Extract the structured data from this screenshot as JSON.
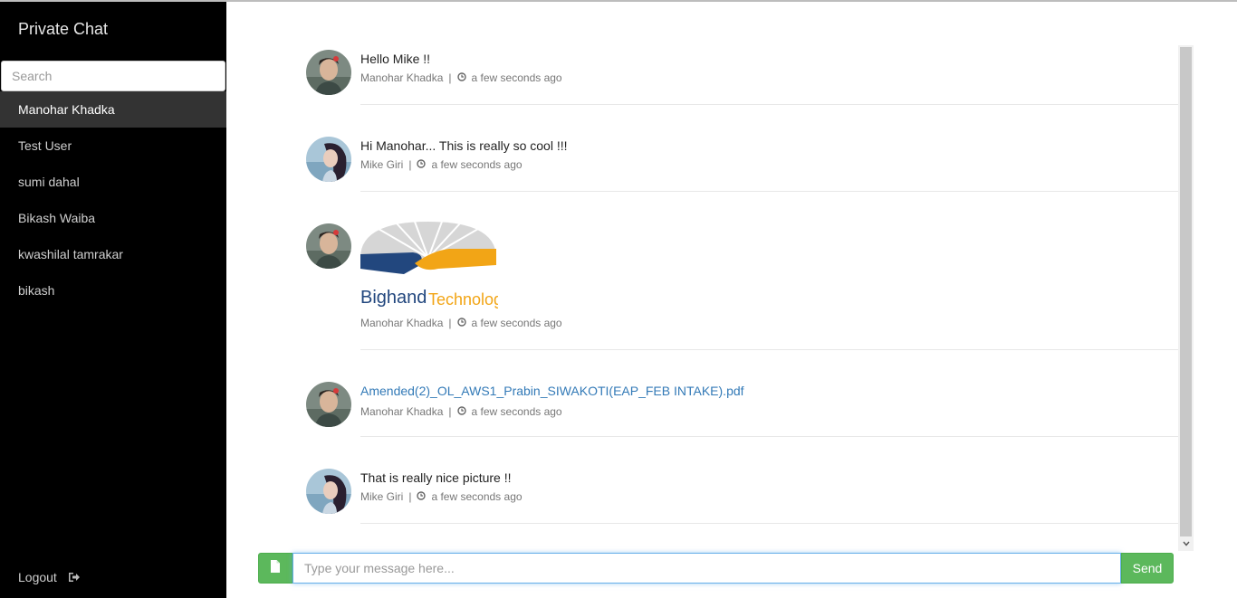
{
  "sidebar": {
    "title": "Private Chat",
    "search_placeholder": "Search",
    "users": [
      {
        "name": "Manohar Khadka",
        "active": true
      },
      {
        "name": "Test User",
        "active": false
      },
      {
        "name": "sumi dahal",
        "active": false
      },
      {
        "name": "Bikash Waiba",
        "active": false
      },
      {
        "name": "kwashilal tamrakar",
        "active": false
      },
      {
        "name": "bikash",
        "active": false
      }
    ],
    "logout_label": "Logout"
  },
  "messages": [
    {
      "type": "text",
      "text": "Hello Mike !!",
      "sender": "Manohar Khadka",
      "time": "a few seconds ago",
      "avatar": "male"
    },
    {
      "type": "text",
      "text": "Hi Manohar... This is really so cool !!!",
      "sender": "Mike Giri",
      "time": "a few seconds ago",
      "avatar": "female"
    },
    {
      "type": "image",
      "image_text": {
        "word1": "Bighand",
        "word2": "Technology"
      },
      "sender": "Manohar Khadka",
      "time": "a few seconds ago",
      "avatar": "male"
    },
    {
      "type": "file",
      "text": "Amended(2)_OL_AWS1_Prabin_SIWAKOTI(EAP_FEB INTAKE).pdf",
      "sender": "Manohar Khadka",
      "time": "a few seconds ago",
      "avatar": "male"
    },
    {
      "type": "text",
      "text": "That is really nice picture !!",
      "sender": "Mike Giri",
      "time": "a few seconds ago",
      "avatar": "female"
    }
  ],
  "meta_separator": "|",
  "composer": {
    "placeholder": "Type your message here...",
    "send_label": "Send"
  },
  "colors": {
    "accent_green": "#5cb85c",
    "link_blue": "#337ab7",
    "sidebar_bg": "#000000",
    "active_item": "#333333"
  }
}
